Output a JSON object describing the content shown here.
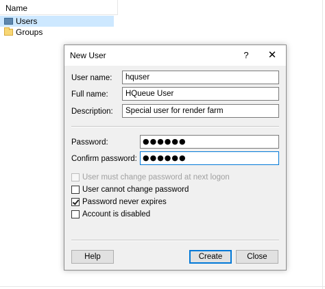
{
  "explorer": {
    "column_header": "Name",
    "items": [
      {
        "label": "Users",
        "icon": "users-folder-icon"
      },
      {
        "label": "Groups",
        "icon": "folder-icon"
      }
    ]
  },
  "dialog": {
    "title": "New User",
    "help_glyph": "?",
    "close_glyph": "✕",
    "user_name": {
      "label": "User name:",
      "value": "hquser"
    },
    "full_name": {
      "label": "Full name:",
      "value": "HQueue User"
    },
    "description": {
      "label": "Description:",
      "value": "Special user for render farm"
    },
    "password": {
      "label": "Password:",
      "value": "●●●●●●"
    },
    "confirm_password": {
      "label": "Confirm password:",
      "value": "●●●●●●"
    },
    "options": [
      {
        "label": "User must change password at next logon",
        "checked": false,
        "enabled": false
      },
      {
        "label": "User cannot change password",
        "checked": false,
        "enabled": true
      },
      {
        "label": "Password never expires",
        "checked": true,
        "enabled": true
      },
      {
        "label": "Account is disabled",
        "checked": false,
        "enabled": true
      }
    ],
    "buttons": {
      "help": "Help",
      "create": "Create",
      "close": "Close"
    }
  },
  "colors": {
    "selection": "#cde8ff",
    "focus_border": "#0078d7",
    "dialog_bg": "#f0f0f0"
  }
}
